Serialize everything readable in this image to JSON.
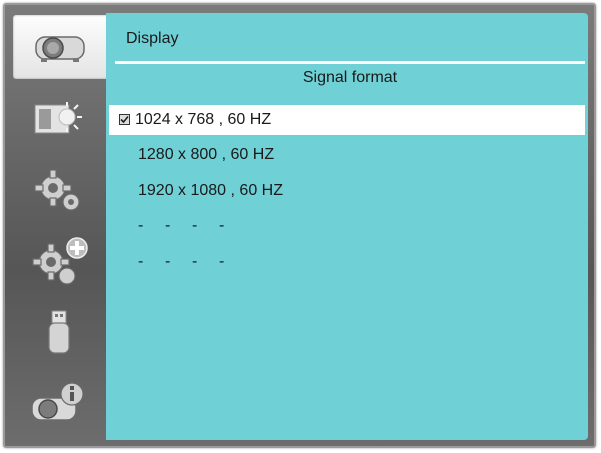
{
  "panel": {
    "title": "Display",
    "section": "Signal format"
  },
  "signal_formats": [
    {
      "label": "1024 x 768 , 60 HZ",
      "selected": true,
      "checked": true
    },
    {
      "label": "1280 x 800 , 60 HZ",
      "selected": false,
      "checked": false
    },
    {
      "label": "1920 x 1080 , 60 HZ",
      "selected": false,
      "checked": false
    }
  ],
  "empty_slots": [
    [
      "-",
      "-",
      "-",
      "-"
    ],
    [
      "-",
      "-",
      "-",
      "-"
    ]
  ],
  "rail": [
    {
      "icon": "projector-icon",
      "selected": true
    },
    {
      "icon": "picture-brightness-icon",
      "selected": false
    },
    {
      "icon": "settings-gear-icon",
      "selected": false
    },
    {
      "icon": "advanced-settings-gear-plus-icon",
      "selected": false
    },
    {
      "icon": "usb-icon",
      "selected": false
    },
    {
      "icon": "projector-info-icon",
      "selected": false
    }
  ],
  "colors": {
    "panel_bg": "#6fd0d6",
    "selection_bg": "#ffffff",
    "rail_bg": "#565656"
  }
}
